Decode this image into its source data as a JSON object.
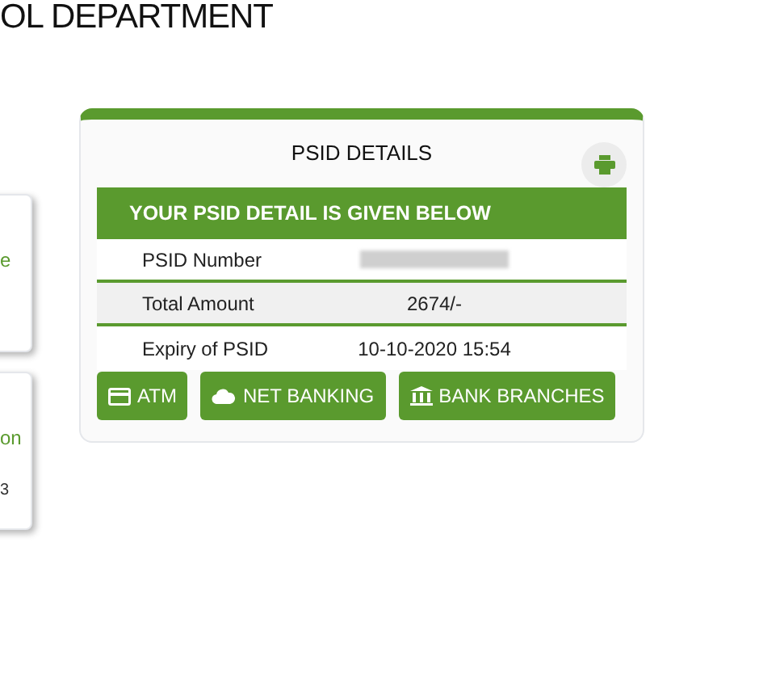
{
  "header": {
    "title": "OL DEPARTMENT"
  },
  "side_cards": [
    {
      "text": "e"
    },
    {
      "text": "on",
      "text_2": "3"
    }
  ],
  "psid_card": {
    "title": "PSID DETAILS",
    "banner": "YOUR PSID DETAIL IS GIVEN BELOW",
    "rows": [
      {
        "label": "PSID Number",
        "redacted": true
      },
      {
        "label": "Total Amount",
        "value": "2674/-",
        "redacted": false
      },
      {
        "label": "Expiry of PSID",
        "value": "10-10-2020 15:54",
        "redacted": false
      }
    ],
    "buttons": [
      {
        "label": "ATM",
        "kind": "card"
      },
      {
        "label": "NET BANKING",
        "kind": "cloud"
      },
      {
        "label": "BANK BRANCHES",
        "kind": "bank"
      }
    ]
  }
}
